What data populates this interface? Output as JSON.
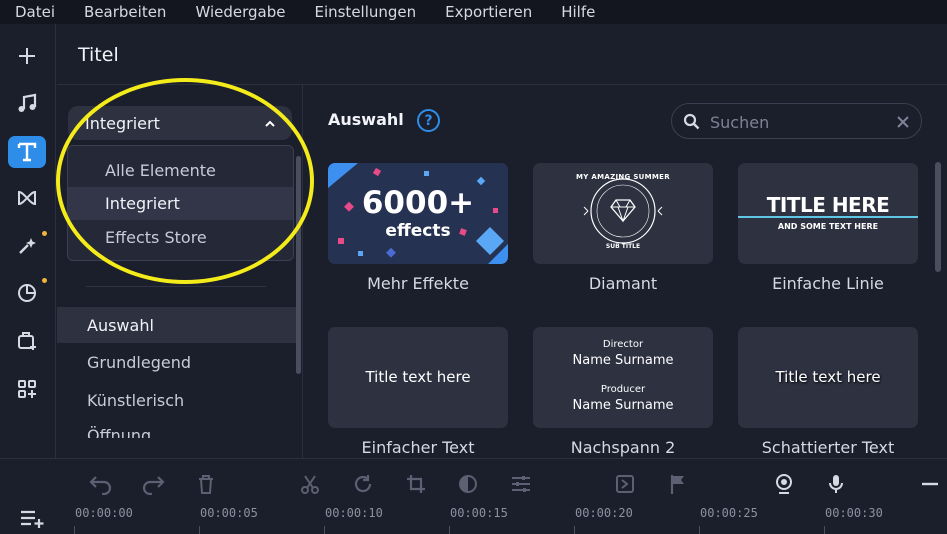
{
  "menu": [
    "Datei",
    "Bearbeiten",
    "Wiedergabe",
    "Einstellungen",
    "Exportieren",
    "Hilfe"
  ],
  "rail_icons": [
    "add-icon",
    "music-icon",
    "titles-icon",
    "transitions-icon",
    "effects-icon",
    "stickers-icon",
    "media-store-icon",
    "more-apps-icon"
  ],
  "panel": {
    "title": "Titel",
    "dropdown": {
      "selected": "Integriert",
      "options": [
        "Alle Elemente",
        "Integriert",
        "Effects Store"
      ]
    },
    "categories": [
      "Auswahl",
      "Grundlegend",
      "Künstlerisch",
      "Öffnung"
    ]
  },
  "content": {
    "section_title": "Auswahl",
    "search_placeholder": "Suchen",
    "tiles": [
      {
        "label": "Mehr Effekte",
        "big": "6000+",
        "small": "effects"
      },
      {
        "label": "Diamant",
        "arc_top": "MY AMAZING SUMMER",
        "arc_bottom": "SUB TITLE"
      },
      {
        "label": "Einfache Linie",
        "big": "TITLE HERE",
        "small": "AND SOME TEXT HERE"
      },
      {
        "label": "Einfacher Text",
        "text": "Title text here"
      },
      {
        "label": "Nachspann 2",
        "role1": "Director",
        "name1": "Name Surname",
        "role2": "Producer",
        "name2": "Name Surname"
      },
      {
        "label": "Schattierter Text",
        "text": "Title text here"
      }
    ]
  },
  "timeline": {
    "labels": [
      "00:00:00",
      "00:00:05",
      "00:00:10",
      "00:00:15",
      "00:00:20",
      "00:00:25",
      "00:00:30"
    ]
  },
  "colors": {
    "accent": "#2f8dea",
    "highlight": "#f4ec1a",
    "badge": "#f2b53a"
  }
}
